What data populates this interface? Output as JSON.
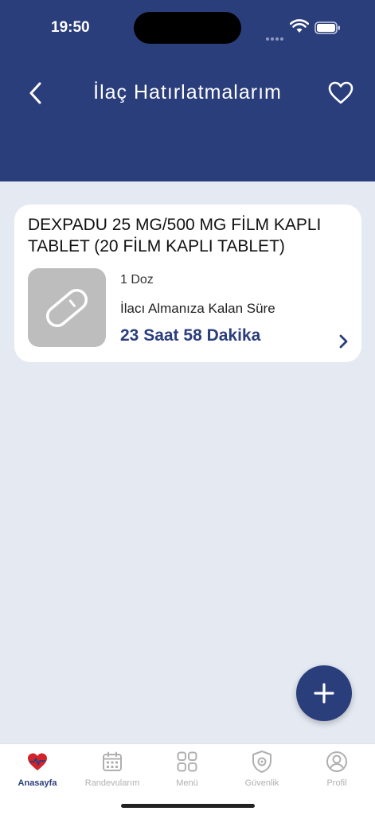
{
  "status": {
    "time": "19:50"
  },
  "header": {
    "title": "İlaç Hatırlatmalarım"
  },
  "reminder": {
    "name": "DEXPADU 25 MG/500 MG FİLM KAPLI TABLET (20 FİLM KAPLI TABLET)",
    "dose": "1 Doz",
    "remaining_label": "İlacı Almanıza Kalan Süre",
    "remaining_value": "23 Saat 58 Dakika"
  },
  "tabs": [
    {
      "label": "Anasayfa",
      "icon": "home-heart-icon",
      "active": true
    },
    {
      "label": "Randevularım",
      "icon": "calendar-icon",
      "active": false
    },
    {
      "label": "Menü",
      "icon": "grid-icon",
      "active": false
    },
    {
      "label": "Güvenlik",
      "icon": "shield-gear-icon",
      "active": false
    },
    {
      "label": "Profil",
      "icon": "user-icon",
      "active": false
    }
  ],
  "colors": {
    "primary": "#2b3e7c",
    "background": "#e5e9f2",
    "pill_box": "#bdbdbd"
  }
}
